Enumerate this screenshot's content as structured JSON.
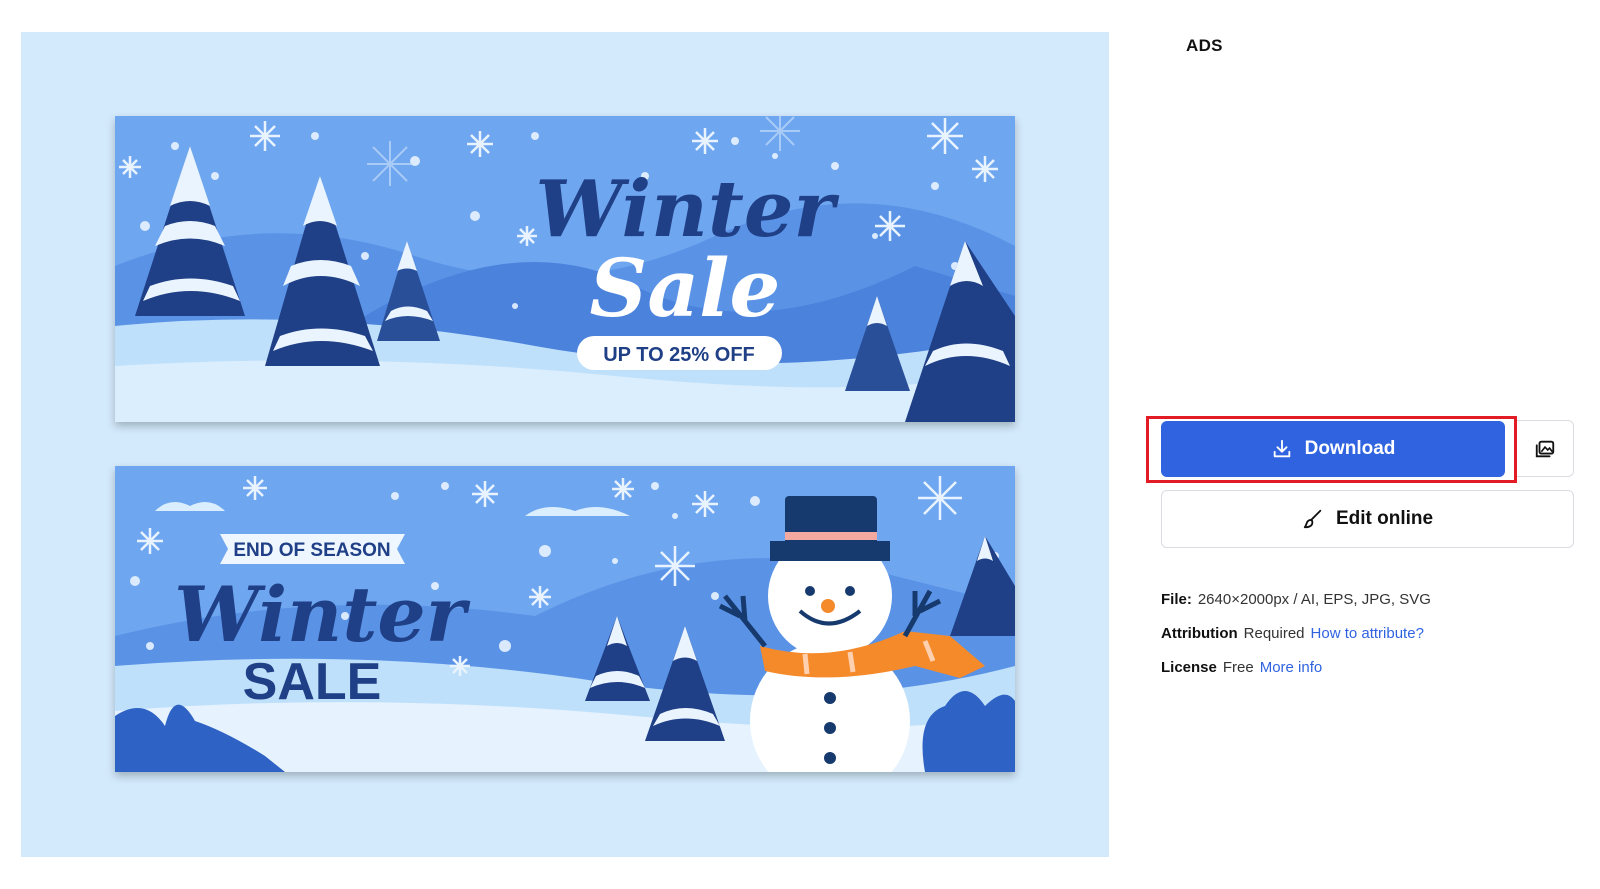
{
  "preview": {
    "banner_top": {
      "title_line1": "Winter",
      "title_line2": "Sale",
      "badge": "UP TO 25% OFF"
    },
    "banner_bottom": {
      "ribbon": "END OF SEASON",
      "title_line1": "Winter",
      "title_line2": "SALE"
    }
  },
  "sidebar": {
    "ads_label": "ADS",
    "download_label": "Download",
    "edit_label": "Edit online",
    "file": {
      "label": "File:",
      "value": "2640×2000px / AI, EPS, JPG, SVG"
    },
    "attribution": {
      "label": "Attribution",
      "value": "Required",
      "link": "How to attribute?"
    },
    "license": {
      "label": "License",
      "value": "Free",
      "link": "More info"
    }
  },
  "colors": {
    "accent": "#2f63e0",
    "highlight": "#e21b25",
    "preview_bg": "#d3eafc",
    "banner_sky": "#6fa6f0",
    "banner_navy": "#1f3f86"
  },
  "icons": [
    "download-icon",
    "add-to-collection-icon",
    "brush-icon"
  ]
}
